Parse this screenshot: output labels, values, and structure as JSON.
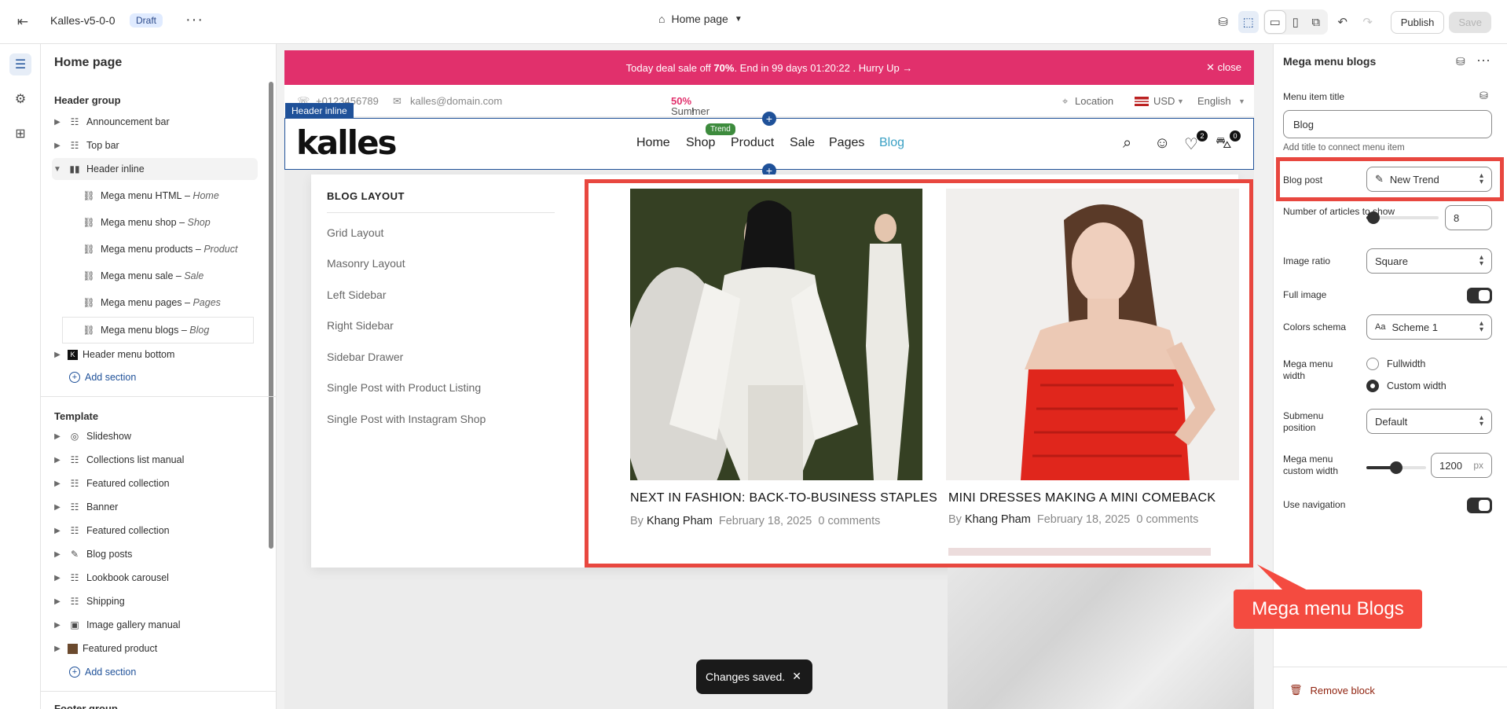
{
  "topbar": {
    "theme_name": "Kalles-v5-0-0",
    "status": "Draft",
    "page": "Home page",
    "publish": "Publish",
    "save": "Save"
  },
  "left_panel": {
    "title": "Home page",
    "header_group": {
      "label": "Header group",
      "items": [
        "Announcement bar",
        "Top bar",
        "Header inline"
      ],
      "subitems": [
        {
          "name": "Mega menu HTML",
          "suffix": "Home"
        },
        {
          "name": "Mega menu shop",
          "suffix": "Shop"
        },
        {
          "name": "Mega menu products",
          "suffix": "Product"
        },
        {
          "name": "Mega menu sale",
          "suffix": "Sale"
        },
        {
          "name": "Mega menu pages",
          "suffix": "Pages"
        },
        {
          "name": "Mega menu blogs",
          "suffix": "Blog"
        }
      ],
      "after": "Header menu bottom",
      "add": "Add section"
    },
    "template": {
      "label": "Template",
      "items": [
        "Slideshow",
        "Collections list manual",
        "Featured collection",
        "Banner",
        "Featured collection",
        "Blog posts",
        "Lookbook carousel",
        "Shipping",
        "Image gallery manual",
        "Featured product"
      ],
      "add": "Add section"
    },
    "footer_group": "Footer group"
  },
  "store": {
    "deal": {
      "pre": "Today deal sale off ",
      "bold": "70%",
      "post": ". End in 99 days 01:20:22 .  Hurry Up →",
      "close": "✕ close"
    },
    "info": {
      "phone": "+0123456789",
      "email": "kalles@domain.com",
      "promo_pre": "Summer sale discount off ",
      "promo_pct": "50%",
      "promo_post": "! Shop Now",
      "location": "Location",
      "currency": "USD",
      "language": "English"
    },
    "header_tag": "Header inline",
    "logo": "kalles",
    "nav": [
      "Home",
      "Shop",
      "Product",
      "Sale",
      "Pages",
      "Blog"
    ],
    "trend": "Trend",
    "wishlist_count": "2",
    "cart_count": "0",
    "mega": {
      "title": "BLOG LAYOUT",
      "links": [
        "Grid Layout",
        "Masonry Layout",
        "Left Sidebar",
        "Right Sidebar",
        "Sidebar Drawer",
        "Single Post with Product Listing",
        "Single Post with Instagram Shop"
      ]
    },
    "articles": [
      {
        "title": "NEXT IN FASHION: BACK-TO-BUSINESS STAPLES",
        "by": "By",
        "author": "Khang Pham",
        "date": "February 18, 2025",
        "comments": "0 comments"
      },
      {
        "title": "MINI DRESSES MAKING A MINI COMEBACK",
        "by": "By",
        "author": "Khang Pham",
        "date": "February 18, 2025",
        "comments": "0 comments"
      }
    ]
  },
  "toast": "Changes saved.",
  "right_panel": {
    "title": "Mega menu blogs",
    "menu_item_title": {
      "label": "Menu item title",
      "value": "Blog",
      "help": "Add title to connect menu item"
    },
    "blog_post": {
      "label": "Blog post",
      "value": "New Trend"
    },
    "articles": {
      "label": "Number of articles to show",
      "value": "8",
      "level": 0.1
    },
    "image_ratio": {
      "label": "Image ratio",
      "value": "Square"
    },
    "full_image": {
      "label": "Full image",
      "on": true
    },
    "colors": {
      "label": "Colors schema",
      "value": "Scheme 1"
    },
    "width": {
      "label": "Mega menu width",
      "options": [
        "Fullwidth",
        "Custom width"
      ],
      "selected": "Custom width"
    },
    "submenu": {
      "label": "Submenu position",
      "value": "Default"
    },
    "custom_width": {
      "label": "Mega menu custom width",
      "value": "1200",
      "unit": "px",
      "level": 0.5
    },
    "nav": {
      "label": "Use navigation",
      "on": true
    },
    "remove": "Remove block"
  },
  "callout": "Mega menu Blogs"
}
